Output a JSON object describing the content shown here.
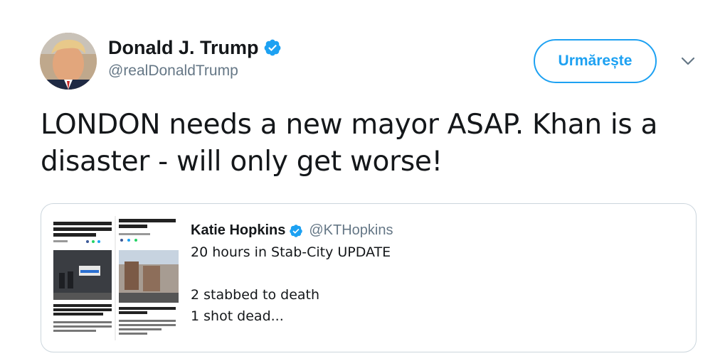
{
  "author": {
    "display_name": "Donald J. Trump",
    "handle": "@realDonaldTrump",
    "verified": true
  },
  "follow_button": {
    "label": "Urmărește"
  },
  "tweet": {
    "line1": "LONDON needs a new mayor ASAP. Khan is a",
    "line2": "disaster - will only get worse!"
  },
  "quoted_tweet": {
    "display_name": "Katie Hopkins",
    "handle": "@KTHopkins",
    "verified": true,
    "line1": "20 hours in Stab-City UPDATE",
    "line2": "2 stabbed to death",
    "line3": "1 shot dead..."
  },
  "colors": {
    "accent": "#1da1f2",
    "text": "#14171a",
    "secondary": "#657786",
    "border": "#ccd6dd"
  }
}
